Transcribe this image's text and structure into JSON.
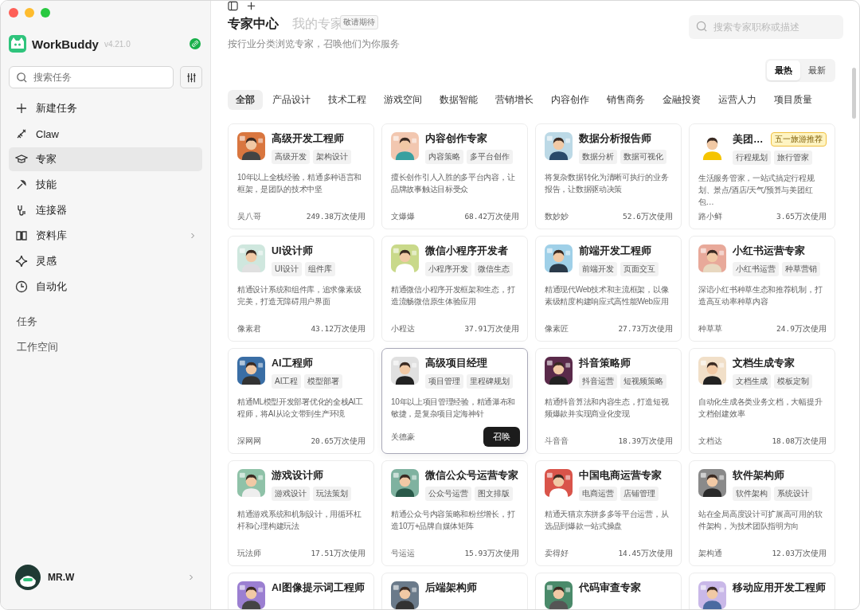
{
  "app": {
    "name": "WorkBuddy",
    "version": "v4.21.0"
  },
  "sidebar": {
    "search": {
      "placeholder": "搜索任务"
    },
    "items": [
      {
        "label": "新建任务",
        "selected": false,
        "expandable": false
      },
      {
        "label": "Claw",
        "selected": false,
        "expandable": false
      },
      {
        "label": "专家",
        "selected": true,
        "expandable": false
      },
      {
        "label": "技能",
        "selected": false,
        "expandable": false
      },
      {
        "label": "连接器",
        "selected": false,
        "expandable": false
      },
      {
        "label": "资料库",
        "selected": false,
        "expandable": true
      },
      {
        "label": "灵感",
        "selected": false,
        "expandable": false
      },
      {
        "label": "自动化",
        "selected": false,
        "expandable": false
      }
    ],
    "sections": [
      "任务",
      "工作空间"
    ],
    "user": {
      "name": "MR.W"
    }
  },
  "header": {
    "title": "专家中心",
    "tab": {
      "label": "我的专家",
      "disabled": true,
      "badge": "敬请期待"
    },
    "subtitle": "按行业分类浏览专家，召唤他们为你服务",
    "search": {
      "placeholder": "搜索专家职称或描述"
    }
  },
  "sort": [
    {
      "label": "最热",
      "selected": true
    },
    {
      "label": "最新",
      "selected": false
    }
  ],
  "categories": [
    {
      "label": "全部",
      "selected": true
    },
    {
      "label": "产品设计",
      "selected": false
    },
    {
      "label": "技术工程",
      "selected": false
    },
    {
      "label": "游戏空间",
      "selected": false
    },
    {
      "label": "数据智能",
      "selected": false
    },
    {
      "label": "营销增长",
      "selected": false
    },
    {
      "label": "内容创作",
      "selected": false
    },
    {
      "label": "销售商务",
      "selected": false
    },
    {
      "label": "金融投资",
      "selected": false
    },
    {
      "label": "运营人力",
      "selected": false
    },
    {
      "label": "项目质量",
      "selected": false
    }
  ],
  "experts": [
    {
      "title": "高级开发工程师",
      "tags": [
        "高级开发",
        "架构设计"
      ],
      "description": "10年以上全栈经验，精通多种语言和框架，是团队的技术中坚",
      "author": "吴八哥",
      "usage": "249.38万次使用",
      "highlighted": false
    },
    {
      "title": "内容创作专家",
      "tags": [
        "内容策略",
        "多平台创作"
      ],
      "description": "擅长创作引人入胜的多平台内容，让品牌故事触达目标受众",
      "author": "文爆爆",
      "usage": "68.42万次使用",
      "highlighted": false
    },
    {
      "title": "数据分析报告师",
      "tags": [
        "数据分析",
        "数据可视化"
      ],
      "description": "将复杂数据转化为清晰可执行的业务报告，让数据驱动决策",
      "author": "数妙妙",
      "usage": "52.6万次使用",
      "highlighted": false
    },
    {
      "title": "美团…",
      "badge": "五一旅游推荐",
      "tags": [
        "行程规划",
        "旅行管家"
      ],
      "description": "生活服务管家，一站式搞定行程规划、景点/酒店/天气/预算与美团红包…",
      "author": "路小鲜",
      "usage": "3.65万次使用",
      "highlighted": false
    },
    {
      "title": "UI设计师",
      "tags": [
        "UI设计",
        "组件库"
      ],
      "description": "精通设计系统和组件库，追求像素级完美，打造无障碍用户界面",
      "author": "像素君",
      "usage": "43.12万次使用",
      "highlighted": false
    },
    {
      "title": "微信小程序开发者",
      "tags": [
        "小程序开发",
        "微信生态"
      ],
      "description": "精通微信小程序开发框架和生态，打造流畅微信原生体验应用",
      "author": "小程达",
      "usage": "37.91万次使用",
      "highlighted": false
    },
    {
      "title": "前端开发工程师",
      "tags": [
        "前端开发",
        "页面交互"
      ],
      "description": "精通现代Web技术和主流框架，以像素级精度构建响应式高性能Web应用",
      "author": "像素匠",
      "usage": "27.73万次使用",
      "highlighted": false
    },
    {
      "title": "小红书运营专家",
      "tags": [
        "小红书运营",
        "种草营销"
      ],
      "description": "深谙小红书种草生态和推荐机制，打造高互动率种草内容",
      "author": "种草草",
      "usage": "24.9万次使用",
      "highlighted": false
    },
    {
      "title": "AI工程师",
      "tags": [
        "AI工程",
        "模型部署"
      ],
      "description": "精通ML模型开发部署优化的全栈AI工程师，将AI从论文带到生产环境",
      "author": "深网网",
      "usage": "20.65万次使用",
      "highlighted": false
    },
    {
      "title": "高级项目经理",
      "tags": [
        "项目管理",
        "里程碑规划"
      ],
      "description": "10年以上项目管理经验，精通瀑布和敏捷，是复杂项目定海神针",
      "author": "关德豪",
      "action": "召唤",
      "highlighted": true
    },
    {
      "title": "抖音策略师",
      "tags": [
        "抖音运营",
        "短视频策略"
      ],
      "description": "精通抖音算法和内容生态，打造短视频爆款并实现商业化变现",
      "author": "斗音音",
      "usage": "18.39万次使用",
      "highlighted": false
    },
    {
      "title": "文档生成专家",
      "tags": [
        "文档生成",
        "模板定制"
      ],
      "description": "自动化生成各类业务文档，大幅提升文档创建效率",
      "author": "文档达",
      "usage": "18.08万次使用",
      "highlighted": false
    },
    {
      "title": "游戏设计师",
      "tags": [
        "游戏设计",
        "玩法策划"
      ],
      "description": "精通游戏系统和机制设计，用循环杠杆和心理构建玩法",
      "author": "玩法师",
      "usage": "17.51万次使用",
      "highlighted": false
    },
    {
      "title": "微信公众号运营专家",
      "tags": [
        "公众号运营",
        "图文排版"
      ],
      "description": "精通公众号内容策略和粉丝增长，打造10万+品牌自媒体矩阵",
      "author": "号运运",
      "usage": "15.93万次使用",
      "highlighted": false
    },
    {
      "title": "中国电商运营专家",
      "tags": [
        "电商运营",
        "店铺管理"
      ],
      "description": "精通天猫京东拼多多等平台运营，从选品到爆款一站式操盘",
      "author": "卖得好",
      "usage": "14.45万次使用",
      "highlighted": false
    },
    {
      "title": "软件架构师",
      "tags": [
        "软件架构",
        "系统设计"
      ],
      "description": "站在全局高度设计可扩展高可用的软件架构，为技术团队指明方向",
      "author": "架构通",
      "usage": "12.03万次使用",
      "highlighted": false
    },
    {
      "title": "AI图像提示词工程师",
      "highlighted": false
    },
    {
      "title": "后端架构师",
      "highlighted": false
    },
    {
      "title": "代码审查专家",
      "highlighted": false
    },
    {
      "title": "移动应用开发工程师",
      "highlighted": false
    }
  ]
}
